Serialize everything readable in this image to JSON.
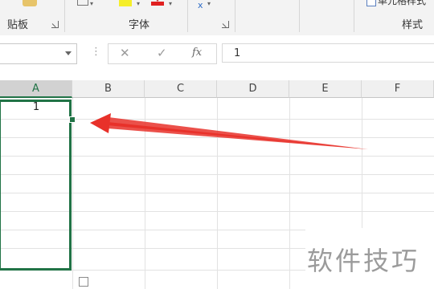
{
  "ribbon": {
    "groups": [
      {
        "id": "clipboard",
        "label": "剪贴板"
      },
      {
        "id": "font",
        "label": "字体"
      },
      {
        "id": "styles",
        "label": "样式"
      }
    ],
    "styles_partial_label": "单元格样式"
  },
  "formula_bar": {
    "namebox_value": "",
    "cancel_icon": "close-icon",
    "enter_icon": "check-icon",
    "fx_label": "fx",
    "content": "1"
  },
  "sheet": {
    "columns": [
      "A",
      "B",
      "C",
      "D",
      "E",
      "F"
    ],
    "selected_column": "A",
    "active_cell": "A1",
    "cells": [
      {
        "ref": "A1",
        "value": "1"
      }
    ]
  },
  "annotation": {
    "arrow_color": "#e8312a"
  },
  "colors": {
    "accent": "#217346"
  },
  "watermark": "软件技巧"
}
